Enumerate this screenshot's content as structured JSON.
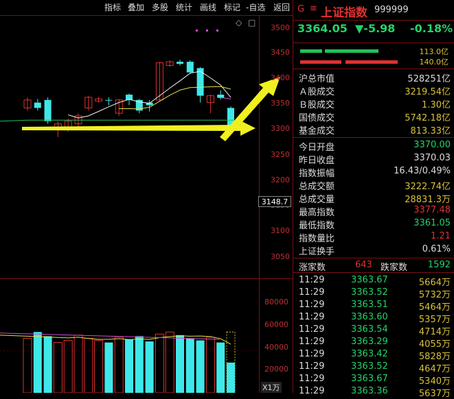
{
  "toolbar": {
    "items": [
      "指标",
      "叠加",
      "多股",
      "统计",
      "画线",
      "标记",
      "-自选",
      "返回"
    ]
  },
  "chart_data": {
    "type": "candlestick",
    "price_axis": {
      "ticks": [
        3500,
        3450,
        3400,
        3350,
        3300,
        3250,
        3200,
        3150,
        3100,
        3050
      ],
      "range": [
        3025,
        3520
      ]
    },
    "current_price_tag": "3148.7",
    "volume_axis": {
      "ticks": [
        "80000",
        "60000",
        "40000",
        "20000"
      ],
      "unit_label": "X1万",
      "range": [
        0,
        100000
      ]
    },
    "candles": [
      {
        "o": 3345,
        "c": 3360,
        "h": 3365,
        "l": 3340
      },
      {
        "o": 3355,
        "c": 3345,
        "h": 3362,
        "l": 3340
      },
      {
        "o": 3360,
        "c": 3320,
        "h": 3365,
        "l": 3315
      },
      {
        "o": 3305,
        "c": 3315,
        "h": 3320,
        "l": 3290
      },
      {
        "o": 3305,
        "c": 3320,
        "h": 3325,
        "l": 3300
      },
      {
        "o": 3315,
        "c": 3330,
        "h": 3335,
        "l": 3310
      },
      {
        "o": 3345,
        "c": 3365,
        "h": 3368,
        "l": 3340
      },
      {
        "o": 3358,
        "c": 3362,
        "h": 3366,
        "l": 3355
      },
      {
        "o": 3360,
        "c": 3359,
        "h": 3365,
        "l": 3350
      },
      {
        "o": 3335,
        "c": 3360,
        "h": 3362,
        "l": 3330
      },
      {
        "o": 3370,
        "c": 3360,
        "h": 3372,
        "l": 3350
      },
      {
        "o": 3360,
        "c": 3340,
        "h": 3362,
        "l": 3335
      },
      {
        "o": 3355,
        "c": 3350,
        "h": 3360,
        "l": 3338
      },
      {
        "o": 3360,
        "c": 3430,
        "h": 3432,
        "l": 3358
      },
      {
        "o": 3425,
        "c": 3432,
        "h": 3435,
        "l": 3422
      },
      {
        "o": 3432,
        "c": 3428,
        "h": 3436,
        "l": 3425
      },
      {
        "o": 3432,
        "c": 3412,
        "h": 3435,
        "l": 3410
      },
      {
        "o": 3420,
        "c": 3368,
        "h": 3422,
        "l": 3355
      },
      {
        "o": 3355,
        "c": 3368,
        "h": 3370,
        "l": 3335
      },
      {
        "o": 3370,
        "c": 3364,
        "h": 3378,
        "l": 3361
      },
      {
        "o": 3345,
        "c": 3312,
        "h": 3348,
        "l": 3310
      }
    ],
    "volumes": [
      52000,
      58000,
      54000,
      48000,
      50000,
      55000,
      52000,
      50000,
      48000,
      53000,
      51000,
      54000,
      49000,
      56000,
      58000,
      55000,
      52000,
      50000,
      53000,
      48000,
      28832
    ],
    "annotations": [
      "yellow arrow pointing up-right toward 3400",
      "yellow arrow pointing right toward 3300"
    ]
  },
  "panel": {
    "g_label": "G",
    "menu_glyph": "≡",
    "name": "上证指数",
    "code": "999999",
    "price": "3364.05",
    "change": "▼-5.98",
    "change_pct": "-0.18%",
    "bar1_label": "113.0亿",
    "bar2_label": "140.0亿",
    "rows1": [
      {
        "k": "沪总市值",
        "v": "528251亿",
        "color": "white"
      },
      {
        "k": "Ａ股成交",
        "v": "3219.54亿",
        "color": "yellow"
      },
      {
        "k": "Ｂ股成交",
        "v": "1.30亿",
        "color": "yellow"
      },
      {
        "k": "国债成交",
        "v": "5742.18亿",
        "color": "yellow"
      },
      {
        "k": "基金成交",
        "v": "813.33亿",
        "color": "yellow"
      }
    ],
    "rows2": [
      {
        "k": "今日开盘",
        "v": "3370.00",
        "color": "green"
      },
      {
        "k": "昨日收盘",
        "v": "3370.03",
        "color": "white"
      },
      {
        "k": "指数振幅",
        "v": "16.43/0.49%",
        "color": "white"
      },
      {
        "k": "总成交额",
        "v": "3222.74亿",
        "color": "yellow"
      },
      {
        "k": "总成交量",
        "v": "28831.3万",
        "color": "yellow"
      },
      {
        "k": "最高指数",
        "v": "3377.48",
        "color": "red"
      },
      {
        "k": "最低指数",
        "v": "3361.05",
        "color": "green"
      },
      {
        "k": "指数量比",
        "v": "1.21",
        "color": "red"
      },
      {
        "k": "上证换手",
        "v": "0.61%",
        "color": "white"
      }
    ],
    "up_label": "涨家数",
    "up_count": "643",
    "down_label": "跌家数",
    "down_count": "1592",
    "ticks": [
      {
        "t": "11:29",
        "p": "3363.67",
        "v": "5664万"
      },
      {
        "t": "11:29",
        "p": "3363.52",
        "v": "5732万"
      },
      {
        "t": "11:29",
        "p": "3363.51",
        "v": "5464万"
      },
      {
        "t": "11:29",
        "p": "3363.60",
        "v": "5357万"
      },
      {
        "t": "11:29",
        "p": "3363.54",
        "v": "4714万"
      },
      {
        "t": "11:29",
        "p": "3363.29",
        "v": "4055万"
      },
      {
        "t": "11:29",
        "p": "3363.42",
        "v": "5828万"
      },
      {
        "t": "11:29",
        "p": "3363.52",
        "v": "4647万"
      },
      {
        "t": "11:29",
        "p": "3363.67",
        "v": "5340万"
      },
      {
        "t": "11:29",
        "p": "3363.36",
        "v": "5637万"
      }
    ]
  }
}
